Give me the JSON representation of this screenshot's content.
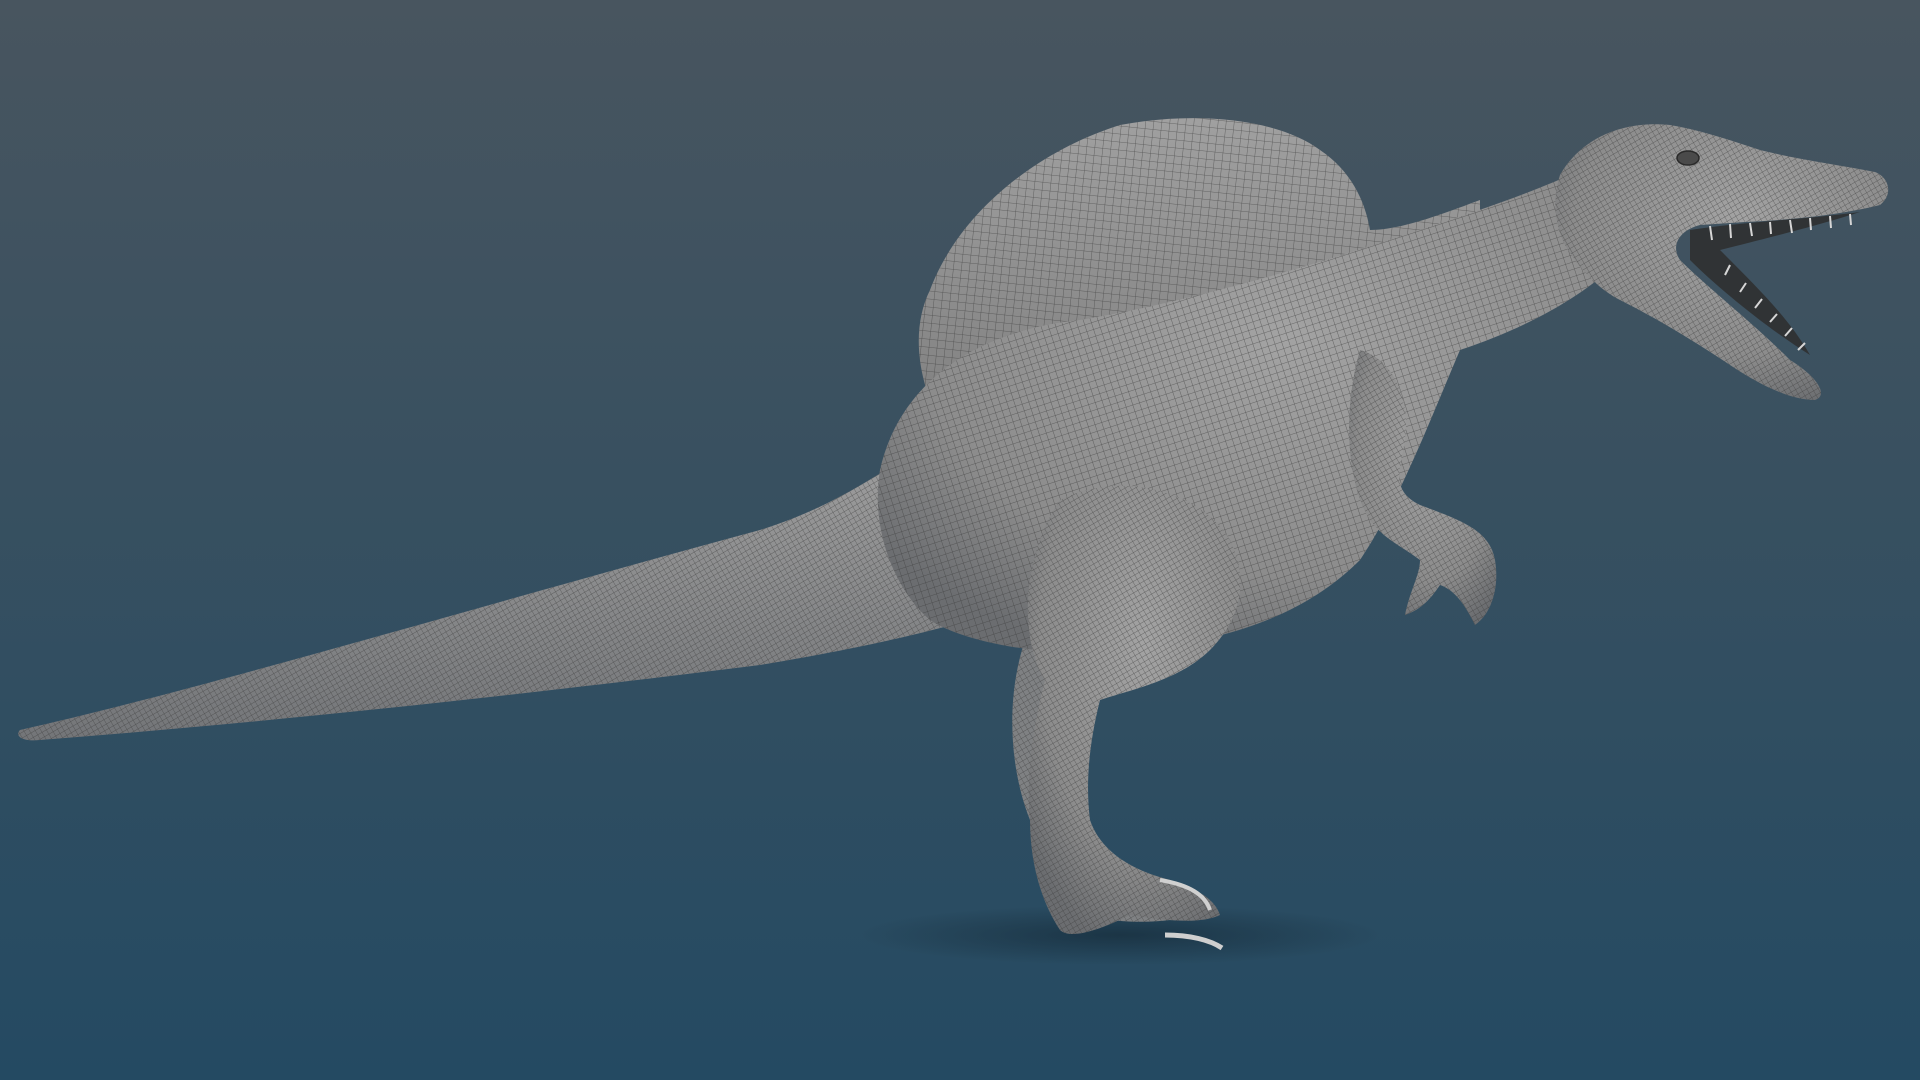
{
  "scene": {
    "subject": "spinosaurus-wireframe-model",
    "background_top": "#48555f",
    "background_bottom": "#244a62",
    "mesh_fill": "#8f8f8f",
    "mesh_light": "#a8a8a8",
    "mesh_shadow": "#5a5d60",
    "wire_color": "#3a3a3a",
    "teeth_color": "#d6d6d6",
    "mouth_color": "#2e2e2e",
    "ground_shadow": "#1a3446",
    "icons": [
      "dinosaur-model"
    ]
  }
}
